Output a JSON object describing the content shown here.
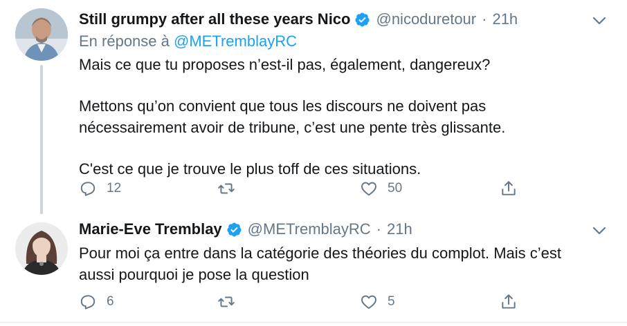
{
  "tweets": [
    {
      "display_name": "Still grumpy after all these years Nico",
      "handle": "@nicoduretour",
      "separator": "·",
      "time": "21h",
      "reply_prefix": "En réponse à",
      "reply_mention": "@METremblayRC",
      "paragraphs": [
        "Mais ce que tu proposes n’est-il pas, également, dangereux?",
        "Mettons qu’on convient que tous les discours ne doivent pas",
        "nécessairement avoir de tribune, c’est une pente très glissante.",
        "C'est ce que je trouve le plus toff de ces situations."
      ],
      "reply_count": "12",
      "retweet_count": "",
      "like_count": "50"
    },
    {
      "display_name": "Marie-Eve Tremblay",
      "handle": "@METremblayRC",
      "separator": "·",
      "time": "21h",
      "paragraphs": [
        "Pour moi ça entre dans la catégorie des théories du complot. Mais c’est",
        "aussi pourquoi je pose la question"
      ],
      "reply_count": "6",
      "retweet_count": "",
      "like_count": "5"
    }
  ],
  "colors": {
    "text_primary": "#14171a",
    "text_secondary": "#657786",
    "accent": "#1da1f2",
    "thread_line": "#ccd6dd"
  },
  "icons": [
    "verified-badge-icon",
    "chevron-down-icon",
    "reply-icon",
    "retweet-icon",
    "like-icon",
    "share-icon"
  ]
}
